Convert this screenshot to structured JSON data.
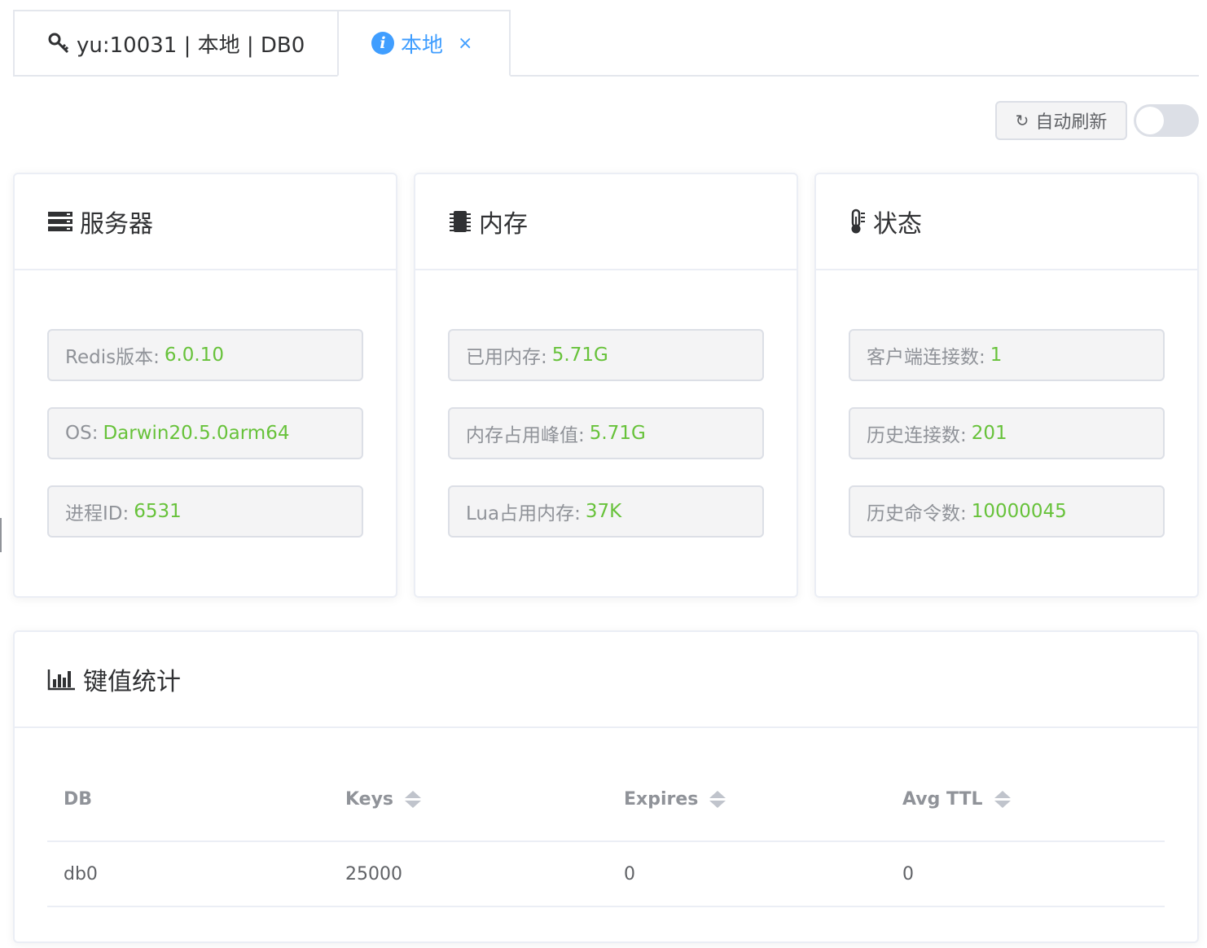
{
  "tabs": [
    {
      "label": "yu:10031 | 本地 | DB0",
      "icon": "key-icon",
      "active": false
    },
    {
      "label": "本地",
      "icon": "info-icon",
      "active": true,
      "close": "×"
    }
  ],
  "toolbar": {
    "refresh_label": "自动刷新",
    "auto_refresh": false
  },
  "colors": {
    "accent": "#409eff",
    "value": "#67c23a",
    "muted": "#909399"
  },
  "server": {
    "title": "服务器",
    "items": [
      {
        "label": "Redis版本:",
        "value": "6.0.10"
      },
      {
        "label": "OS:",
        "value": "Darwin20.5.0arm64"
      },
      {
        "label": "进程ID:",
        "value": "6531"
      }
    ]
  },
  "memory": {
    "title": "内存",
    "items": [
      {
        "label": "已用内存:",
        "value": "5.71G"
      },
      {
        "label": "内存占用峰值:",
        "value": "5.71G"
      },
      {
        "label": "Lua占用内存:",
        "value": "37K"
      }
    ]
  },
  "status": {
    "title": "状态",
    "items": [
      {
        "label": "客户端连接数:",
        "value": "1"
      },
      {
        "label": "历史连接数:",
        "value": "201"
      },
      {
        "label": "历史命令数:",
        "value": "10000045"
      }
    ]
  },
  "keystats": {
    "title": "键值统计",
    "columns": [
      "DB",
      "Keys",
      "Expires",
      "Avg TTL"
    ],
    "rows": [
      {
        "db": "db0",
        "keys": "25000",
        "expires": "0",
        "avg_ttl": "0"
      }
    ]
  }
}
